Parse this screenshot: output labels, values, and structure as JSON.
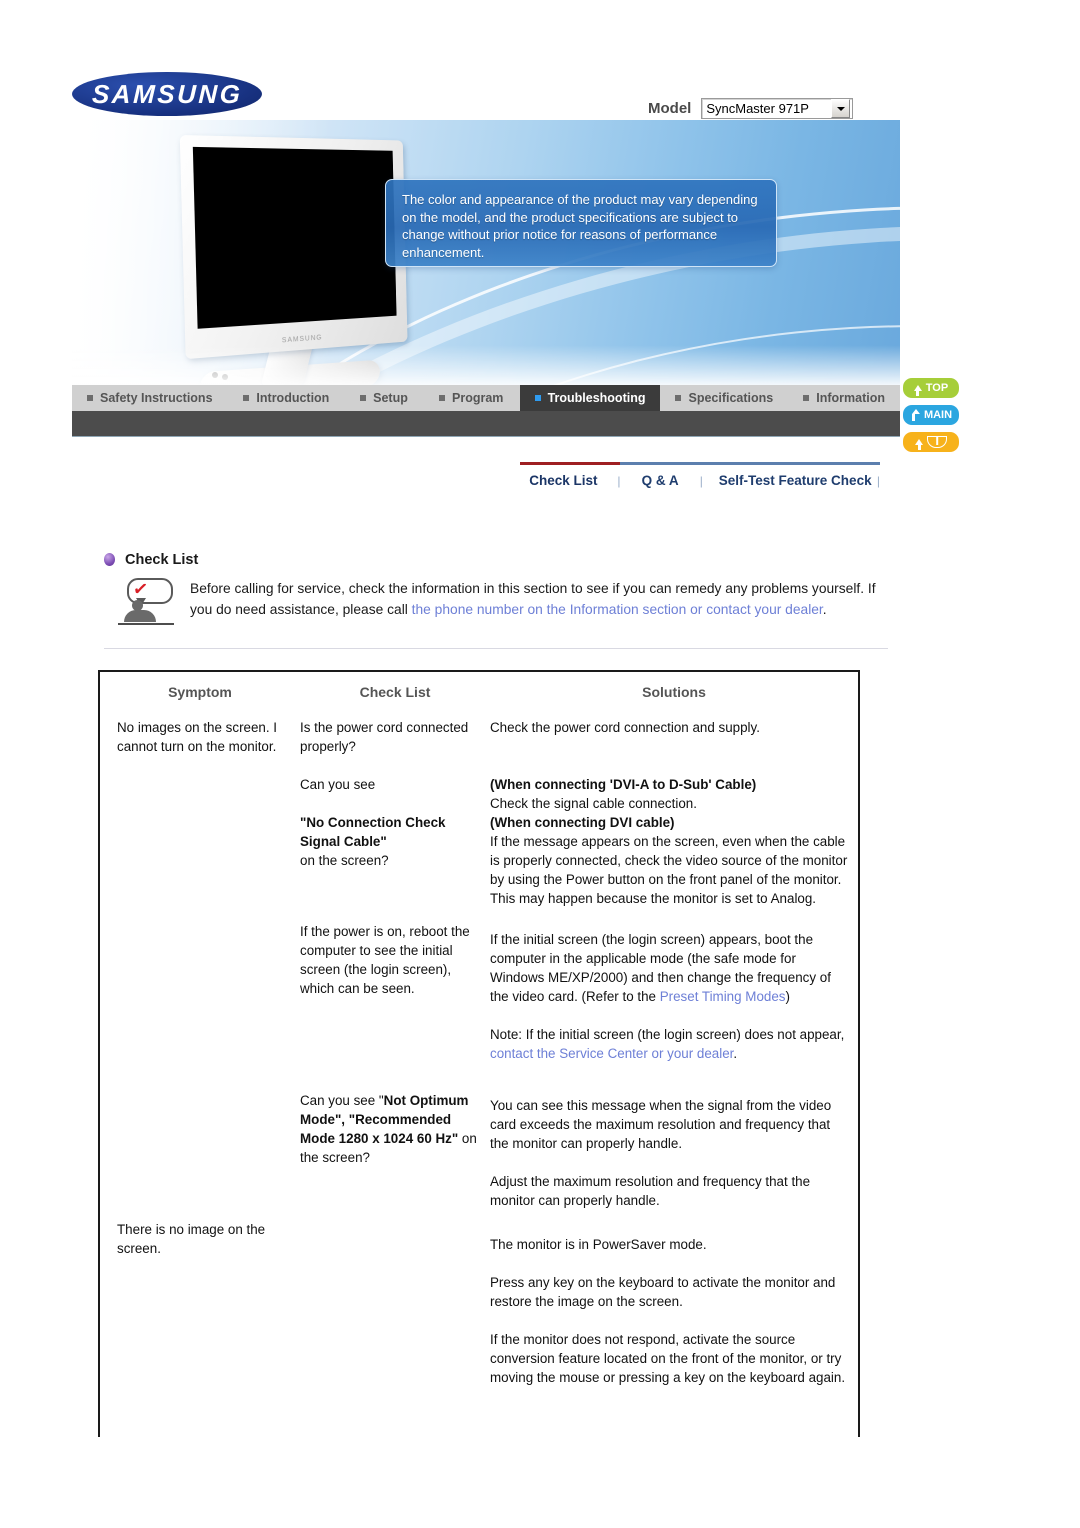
{
  "brand": {
    "logo_text": "SAMSUNG"
  },
  "model": {
    "label": "Model",
    "selected": "SyncMaster 971P"
  },
  "hero": {
    "notice": "The color and appearance of the product may vary depending on the model, and the product specifications are subject to change without prior notice for reasons of performance enhancement."
  },
  "main_nav": {
    "items": [
      {
        "label": "Safety Instructions",
        "active": false
      },
      {
        "label": "Introduction",
        "active": false
      },
      {
        "label": "Setup",
        "active": false
      },
      {
        "label": "Program",
        "active": false
      },
      {
        "label": "Troubleshooting",
        "active": true
      },
      {
        "label": "Specifications",
        "active": false
      },
      {
        "label": "Information",
        "active": false
      }
    ]
  },
  "side_buttons": [
    {
      "label": "TOP",
      "color": "#a6ce39"
    },
    {
      "label": "MAIN",
      "color": "#2ba6e0"
    },
    {
      "label": "",
      "color": "#f7b21b"
    }
  ],
  "sub_nav": {
    "items": [
      {
        "label": "Check List",
        "active": true
      },
      {
        "label": "Q & A",
        "active": false
      },
      {
        "label": "Self-Test Feature Check",
        "active": false
      }
    ],
    "separator": "|",
    "accent_red": "#9e1f22",
    "accent_blue": "#5c7fae"
  },
  "section": {
    "title": "Check List",
    "intro_part1": "Before calling for service, check the information in this section to see if you can remedy any problems yourself. If you do need assistance, please call ",
    "intro_link": "the phone number on the Information section or contact your dealer",
    "intro_end": "."
  },
  "table": {
    "headers": [
      "Symptom",
      "Check List",
      "Solutions"
    ],
    "symptom_1": "No images on the screen. I cannot turn on the monitor.",
    "symptom_2": "There is no image on the screen.",
    "check_1": "Is the power cord connected properly?",
    "check_2a": "Can you see",
    "check_2b": "\"No Connection Check Signal Cable\"",
    "check_2c": "on the screen?",
    "check_3": "If the power is on, reboot the computer to see the initial screen (the login screen), which can be seen.",
    "check_4a": "Can you see \"",
    "check_4b": "Not Optimum Mode\", \"Recommended Mode 1280 x 1024 60 Hz\"",
    "check_4c": " on the screen?",
    "sol_1": "Check the power cord connection and supply.",
    "sol_2_h1": "(When connecting 'DVI-A to D-Sub' Cable)",
    "sol_2_t1": "Check the signal cable connection.",
    "sol_2_h2": "(When connecting DVI cable)",
    "sol_2_t2": "If the message appears on the screen, even when the cable is properly connected, check the video source of the monitor by using the Power button on the front panel of the monitor. This may happen because the monitor is set to Analog.",
    "sol_3a": "If the initial screen (the login screen) appears, boot the computer in the applicable mode (the safe mode for Windows ME/XP/2000) and then change the frequency of the video card. (Refer to the ",
    "sol_3_link": "Preset Timing Modes",
    "sol_3b": ")",
    "sol_4a": "Note: If the initial screen (the login screen) does not appear, ",
    "sol_4_link": "contact the Service Center or your dealer",
    "sol_4b": ".",
    "sol_5": "You can see this message when the signal from the video card exceeds the maximum resolution and frequency that the monitor can properly handle.",
    "sol_6": "Adjust the maximum resolution and frequency that the monitor can properly handle.",
    "sol_7": "The monitor is in PowerSaver mode.",
    "sol_8": "Press any key on the keyboard to activate the monitor and restore the image on the screen.",
    "sol_9": "If the monitor does not respond, activate the source conversion feature located on the front of the monitor, or try moving the mouse or pressing a key on the keyboard again."
  }
}
